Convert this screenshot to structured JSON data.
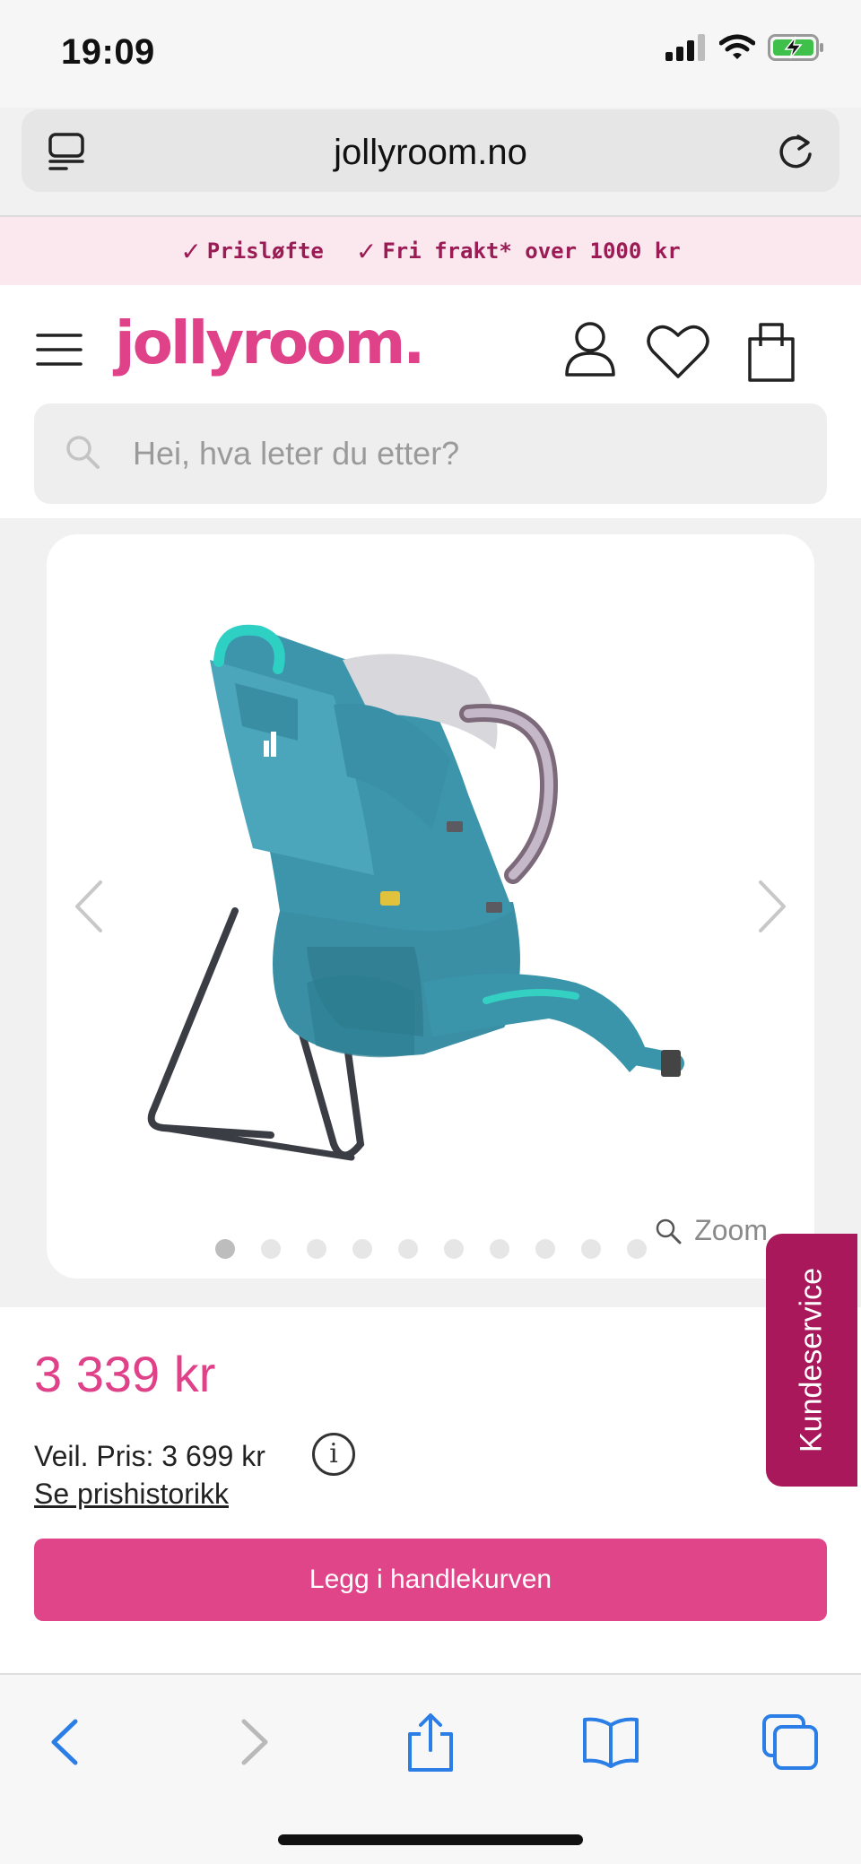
{
  "status_bar": {
    "time": "19:09",
    "icons": [
      "cellular-signal-icon",
      "wifi-icon",
      "battery-charging-icon"
    ]
  },
  "browser": {
    "url": "jollyroom.no",
    "reader_icon": "reader-icon",
    "reload_icon": "reload-icon"
  },
  "promo": {
    "items": [
      "Prisløfte",
      "Fri frakt* over 1000 kr"
    ]
  },
  "header": {
    "logo": "jollyroom.",
    "brand_color": "#e0428a"
  },
  "search": {
    "placeholder": "Hei, hva leter du etter?"
  },
  "gallery": {
    "zoom_label": "Zoom",
    "slide_count": 10,
    "active_slide": 1
  },
  "product": {
    "price": "3 339 kr",
    "rrp": "Veil. Pris: 3 699 kr",
    "info_icon": "i",
    "price_history": "Se prishistorikk",
    "add_to_cart": "Legg i handlekurven"
  },
  "customer_service": {
    "label": "Kundeservice"
  },
  "toolbar": {
    "icons": [
      "back-icon",
      "forward-icon",
      "share-icon",
      "bookmarks-icon",
      "tabs-icon"
    ]
  }
}
